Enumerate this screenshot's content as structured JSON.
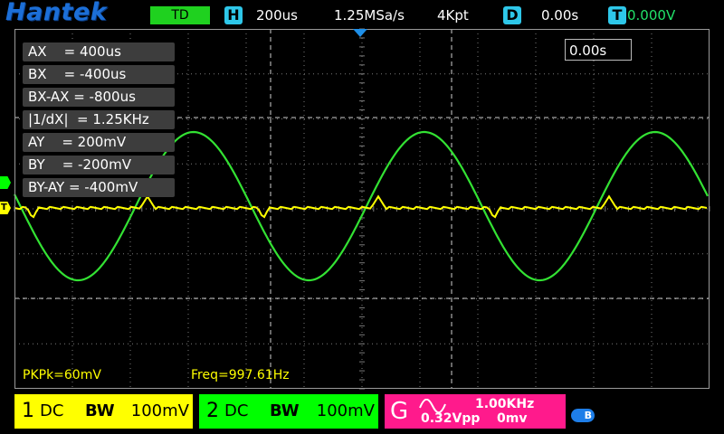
{
  "brand": "Hantek",
  "header": {
    "trigger_mode": "TD",
    "timebase_icon_label": "H",
    "timebase": "200us",
    "sample_rate": "1.25MSa/s",
    "memory_depth": "4Kpt",
    "delay_icon_label": "D",
    "delay": "0.00s",
    "trigger_icon_label": "T",
    "trigger_level": "0.000V"
  },
  "delay_box": "0.00s",
  "cursors": [
    "AX    = 400us",
    "BX    = -400us",
    "BX-AX = -800us",
    "|1/dX|  = 1.25KHz",
    "AY    = 200mV",
    "BY    = -200mV",
    "BY-AY = -400mV"
  ],
  "markers": {
    "ch1_label": "T"
  },
  "measurements": {
    "pkpk": "PKPk=60mV",
    "freq": "Freq=997.61Hz"
  },
  "channels": {
    "ch1": {
      "num": "1",
      "coupling": "DC",
      "bw": "BW",
      "scale": "100mV"
    },
    "ch2": {
      "num": "2",
      "coupling": "DC",
      "bw": "BW",
      "scale": "100mV"
    }
  },
  "generator": {
    "label": "G",
    "waveform_icon": "sine-wave-icon",
    "frequency": "1.00KHz",
    "amplitude": "0.32Vpp",
    "offset": "0mv"
  },
  "status_icons": {
    "bluetooth_icon": "bluetooth-icon",
    "bluetooth_glyph": "B"
  },
  "colors": {
    "ch1": "#ffff00",
    "ch2": "#00ff00",
    "generator": "#ff1a8c",
    "brand": "#1c6fd8",
    "accent": "#2ec7e9"
  }
}
